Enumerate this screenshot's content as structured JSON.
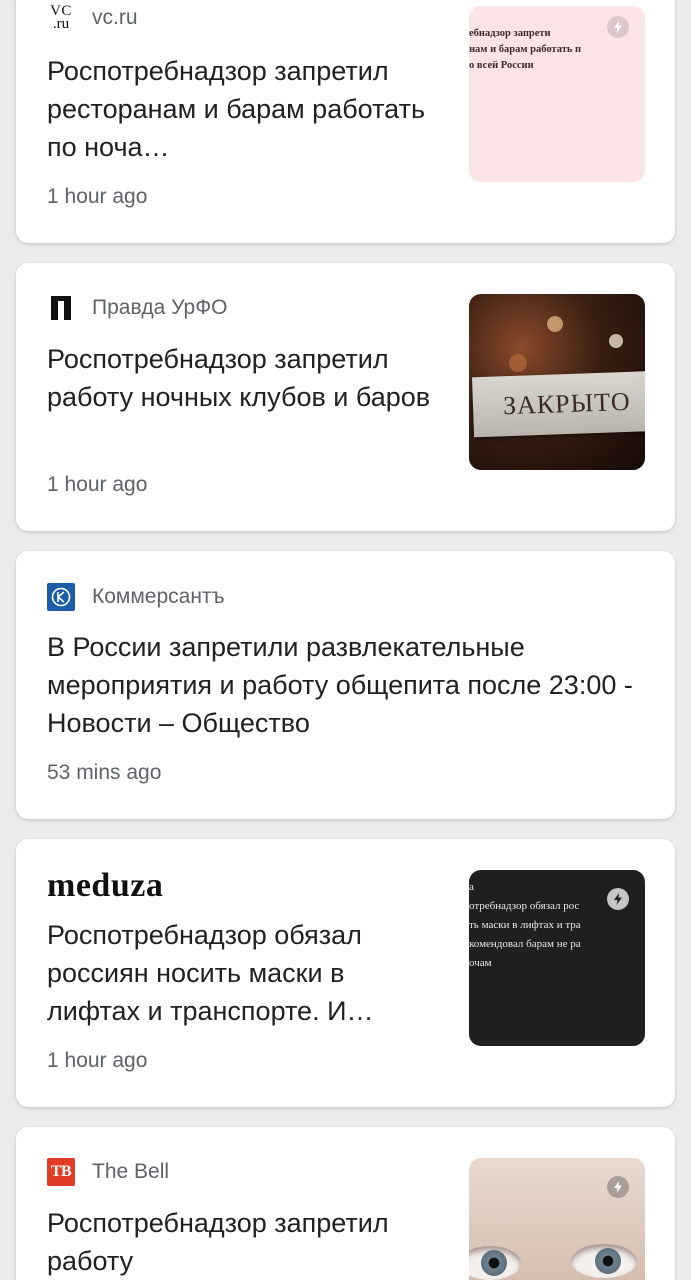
{
  "colors": {
    "background": "#ebebeb",
    "card": "#ffffff",
    "headline": "#202124",
    "meta": "#5f6368",
    "kommersant_logo": "#1b5ea7",
    "thebell_logo": "#e23b26"
  },
  "articles": [
    {
      "source": "vc.ru",
      "logo_icon": "vc-ru-logo-icon",
      "logo_text_top": "VC",
      "logo_text_bottom": ".ru",
      "headline": "Роспотребнадзор запретил ресторанам и барам работать по ноча…",
      "time": "1 hour ago",
      "thumbnail_text": [
        "ебнадзор запрети",
        "нам и барам работать п",
        "о всей России"
      ],
      "amp_icon": true
    },
    {
      "source": "Правда УрФО",
      "logo_icon": "pravda-urfo-logo-icon",
      "headline": "Роспотребнадзор запретил работу ночных клубов и баров",
      "time": "1 hour ago",
      "thumbnail_text": [
        "ЗАКРЫТО"
      ],
      "amp_icon": false
    },
    {
      "source": "Коммерсантъ",
      "logo_icon": "kommersant-logo-icon",
      "headline": "В России запретили развлекательные мероприятия и работу общепита после 23:00 - Новости – Общество",
      "time": "53 mins ago"
    },
    {
      "source": "meduza",
      "logo_icon": "meduza-logo-icon",
      "headline": "Роспотребнадзор обязал россиян носить маски в лифтах и транспорте. И…",
      "time": "1 hour ago",
      "thumbnail_text": [
        "а",
        "отребнадзор обязал рос",
        "ть маски в лифтах и тра",
        "комендовал барам не ра",
        "очам"
      ],
      "amp_icon": true
    },
    {
      "source": "The Bell",
      "logo_icon": "the-bell-logo-icon",
      "logo_text": "TB",
      "headline": "Роспотребнадзор запретил работу",
      "amp_icon": true
    }
  ]
}
